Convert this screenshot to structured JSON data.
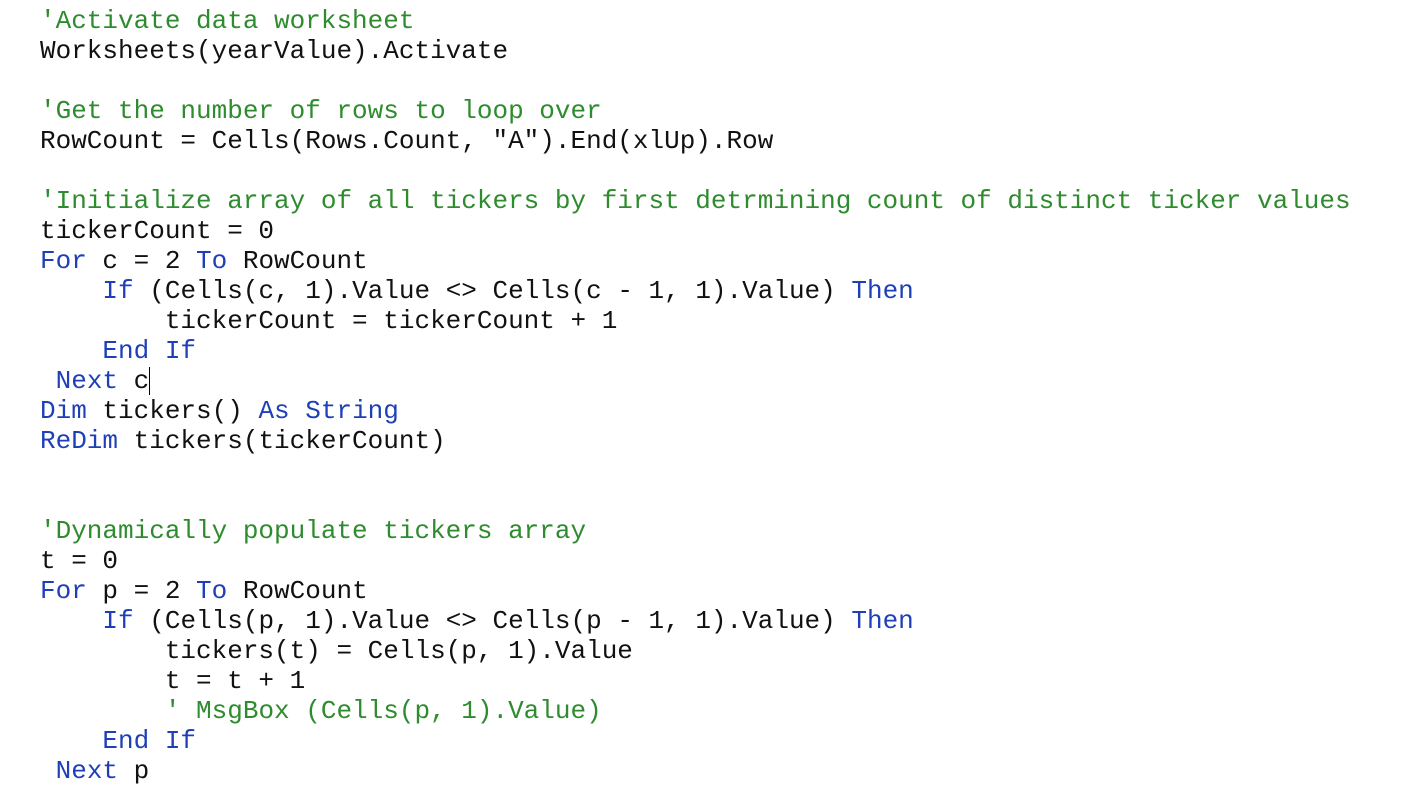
{
  "editor": {
    "colors": {
      "comment": "#2e8b2e",
      "keyword": "#1f3fb8",
      "plain": "#111111"
    },
    "lines": [
      [
        {
          "t": "comment",
          "s": "'Activate data worksheet"
        }
      ],
      [
        {
          "t": "plain",
          "s": "Worksheets(yearValue).Activate"
        }
      ],
      [],
      [
        {
          "t": "comment",
          "s": "'Get the number of rows to loop over"
        }
      ],
      [
        {
          "t": "plain",
          "s": "RowCount = Cells(Rows.Count, \"A\").End(xlUp).Row"
        }
      ],
      [],
      [
        {
          "t": "comment",
          "s": "'Initialize array of all tickers by first detrmining count of distinct ticker values"
        }
      ],
      [
        {
          "t": "plain",
          "s": "tickerCount = 0"
        }
      ],
      [
        {
          "t": "keyword",
          "s": "For"
        },
        {
          "t": "plain",
          "s": " c = 2 "
        },
        {
          "t": "keyword",
          "s": "To"
        },
        {
          "t": "plain",
          "s": " RowCount"
        }
      ],
      [
        {
          "t": "plain",
          "s": "    "
        },
        {
          "t": "keyword",
          "s": "If"
        },
        {
          "t": "plain",
          "s": " (Cells(c, 1).Value <> Cells(c - 1, 1).Value) "
        },
        {
          "t": "keyword",
          "s": "Then"
        }
      ],
      [
        {
          "t": "plain",
          "s": "        tickerCount = tickerCount + 1"
        }
      ],
      [
        {
          "t": "plain",
          "s": "    "
        },
        {
          "t": "keyword",
          "s": "End If"
        }
      ],
      [
        {
          "t": "plain",
          "s": " "
        },
        {
          "t": "keyword",
          "s": "Next"
        },
        {
          "t": "plain",
          "s": " c"
        },
        {
          "t": "caret",
          "s": ""
        }
      ],
      [
        {
          "t": "keyword",
          "s": "Dim"
        },
        {
          "t": "plain",
          "s": " tickers() "
        },
        {
          "t": "keyword",
          "s": "As String"
        }
      ],
      [
        {
          "t": "keyword",
          "s": "ReDim"
        },
        {
          "t": "plain",
          "s": " tickers(tickerCount)"
        }
      ],
      [],
      [],
      [
        {
          "t": "comment",
          "s": "'Dynamically populate tickers array"
        }
      ],
      [
        {
          "t": "plain",
          "s": "t = 0"
        }
      ],
      [
        {
          "t": "keyword",
          "s": "For"
        },
        {
          "t": "plain",
          "s": " p = 2 "
        },
        {
          "t": "keyword",
          "s": "To"
        },
        {
          "t": "plain",
          "s": " RowCount"
        }
      ],
      [
        {
          "t": "plain",
          "s": "    "
        },
        {
          "t": "keyword",
          "s": "If"
        },
        {
          "t": "plain",
          "s": " (Cells(p, 1).Value <> Cells(p - 1, 1).Value) "
        },
        {
          "t": "keyword",
          "s": "Then"
        }
      ],
      [
        {
          "t": "plain",
          "s": "        tickers(t) = Cells(p, 1).Value"
        }
      ],
      [
        {
          "t": "plain",
          "s": "        t = t + 1"
        }
      ],
      [
        {
          "t": "plain",
          "s": "        "
        },
        {
          "t": "comment",
          "s": "' MsgBox (Cells(p, 1).Value)"
        }
      ],
      [
        {
          "t": "plain",
          "s": "    "
        },
        {
          "t": "keyword",
          "s": "End If"
        }
      ],
      [
        {
          "t": "plain",
          "s": " "
        },
        {
          "t": "keyword",
          "s": "Next"
        },
        {
          "t": "plain",
          "s": " p"
        }
      ]
    ]
  }
}
